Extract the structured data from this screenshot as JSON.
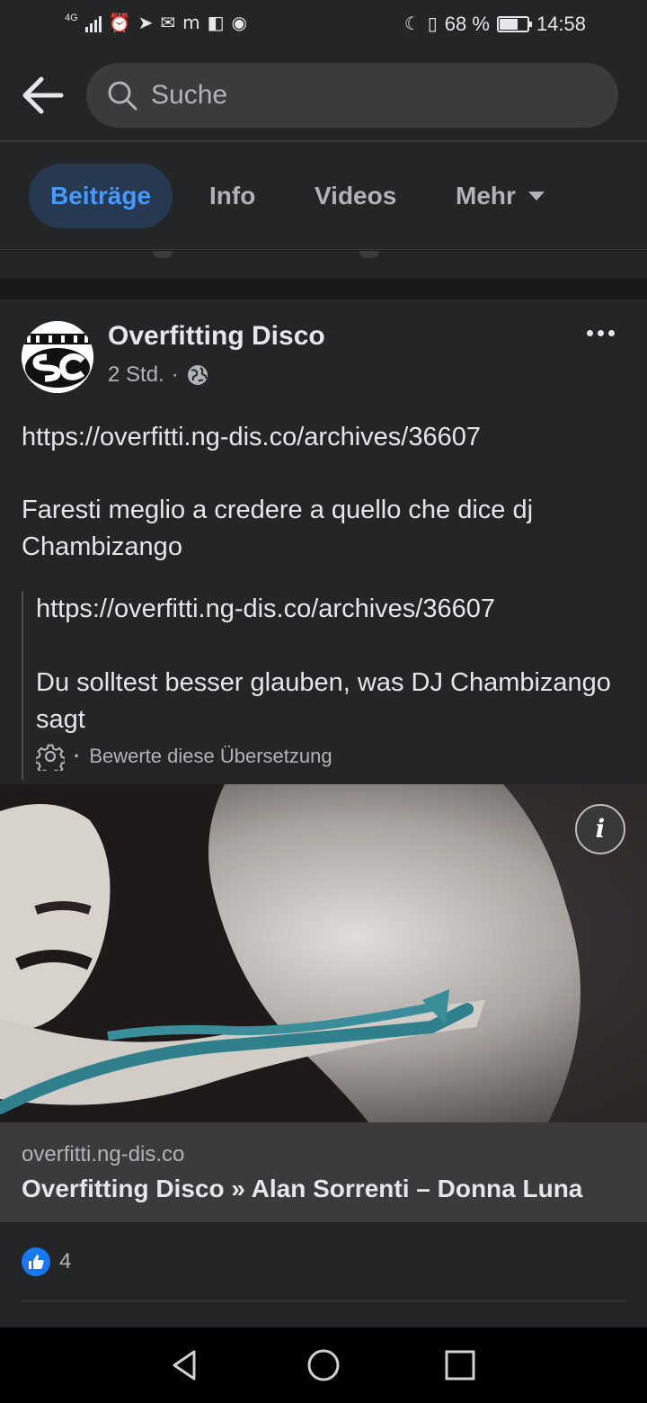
{
  "status_bar": {
    "network": "4G",
    "battery": "68 %",
    "battery_level": 0.68,
    "time": "14:58"
  },
  "search": {
    "placeholder": "Suche",
    "value": ""
  },
  "tabs": [
    {
      "label": "Beiträge",
      "active": true
    },
    {
      "label": "Info",
      "active": false
    },
    {
      "label": "Videos",
      "active": false
    },
    {
      "label": "Mehr",
      "active": false
    }
  ],
  "post": {
    "author": "Overfitting Disco",
    "time": "2 Std.",
    "separator": "·",
    "link": "https://overfitti.ng-dis.co/archives/36607",
    "text": "Faresti meglio a credere a quello che dice dj Chambizango",
    "translation": {
      "link": "https://overfitti.ng-dis.co/archives/36607",
      "text": "Du solltest besser glauben, was DJ Chambizango sagt",
      "rate_label": "Bewerte diese Übersetzung"
    },
    "link_preview": {
      "domain": "overfitti.ng-dis.co",
      "title": "Overfitting Disco » Alan Sorrenti – Donna Luna"
    },
    "like_count": "4"
  },
  "icons": {
    "back": "arrow-left-icon",
    "search": "search-icon",
    "more": "more-horizontal-icon",
    "privacy": "globe-icon",
    "settings": "gear-icon",
    "like": "thumbs-up-icon",
    "info": "info-icon"
  },
  "colors": {
    "background": "#18191a",
    "surface": "#242526",
    "accent": "#4599ff",
    "active_tab_bg": "#263951",
    "like_blue": "#1877f2"
  }
}
